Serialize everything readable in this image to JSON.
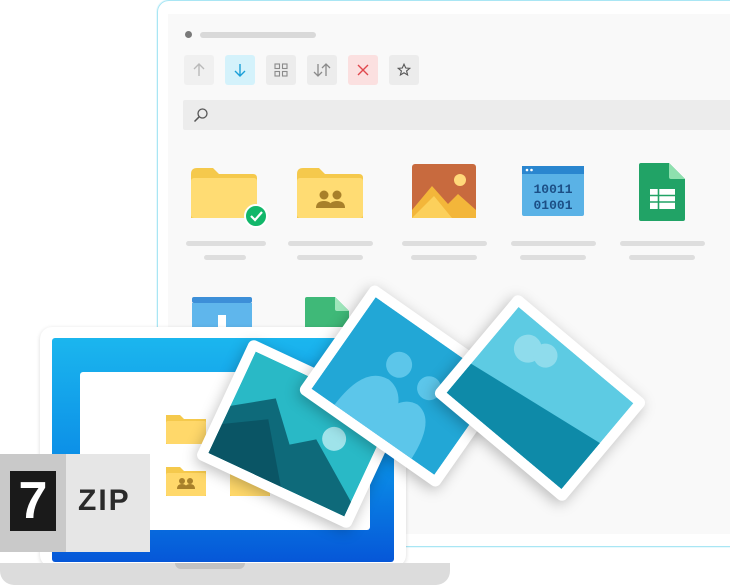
{
  "logo": {
    "number": "7",
    "text": "ZIP"
  },
  "toolbar": {
    "buttons": [
      {
        "icon": "arrow-up-icon"
      },
      {
        "icon": "arrow-down-icon"
      },
      {
        "icon": "grid-icon"
      },
      {
        "icon": "sort-icon"
      },
      {
        "icon": "close-icon"
      },
      {
        "icon": "star-icon"
      }
    ]
  },
  "search": {
    "icon": "search-icon",
    "placeholder": ""
  },
  "files": [
    {
      "icon": "folder-check-icon"
    },
    {
      "icon": "shared-folder-icon"
    },
    {
      "icon": "image-file-icon"
    },
    {
      "icon": "binary-file-icon"
    },
    {
      "icon": "spreadsheet-icon"
    },
    {
      "icon": "archive-file-icon"
    },
    {
      "icon": "document-file-icon"
    }
  ],
  "binary_file": {
    "line1": "10011",
    "line2": "01001"
  },
  "colors": {
    "folder": "#ffd96a",
    "accent": "#0a8ae6",
    "check": "#12b76a",
    "spreadsheet": "#21a366",
    "window_border": "#a9e6f4"
  }
}
